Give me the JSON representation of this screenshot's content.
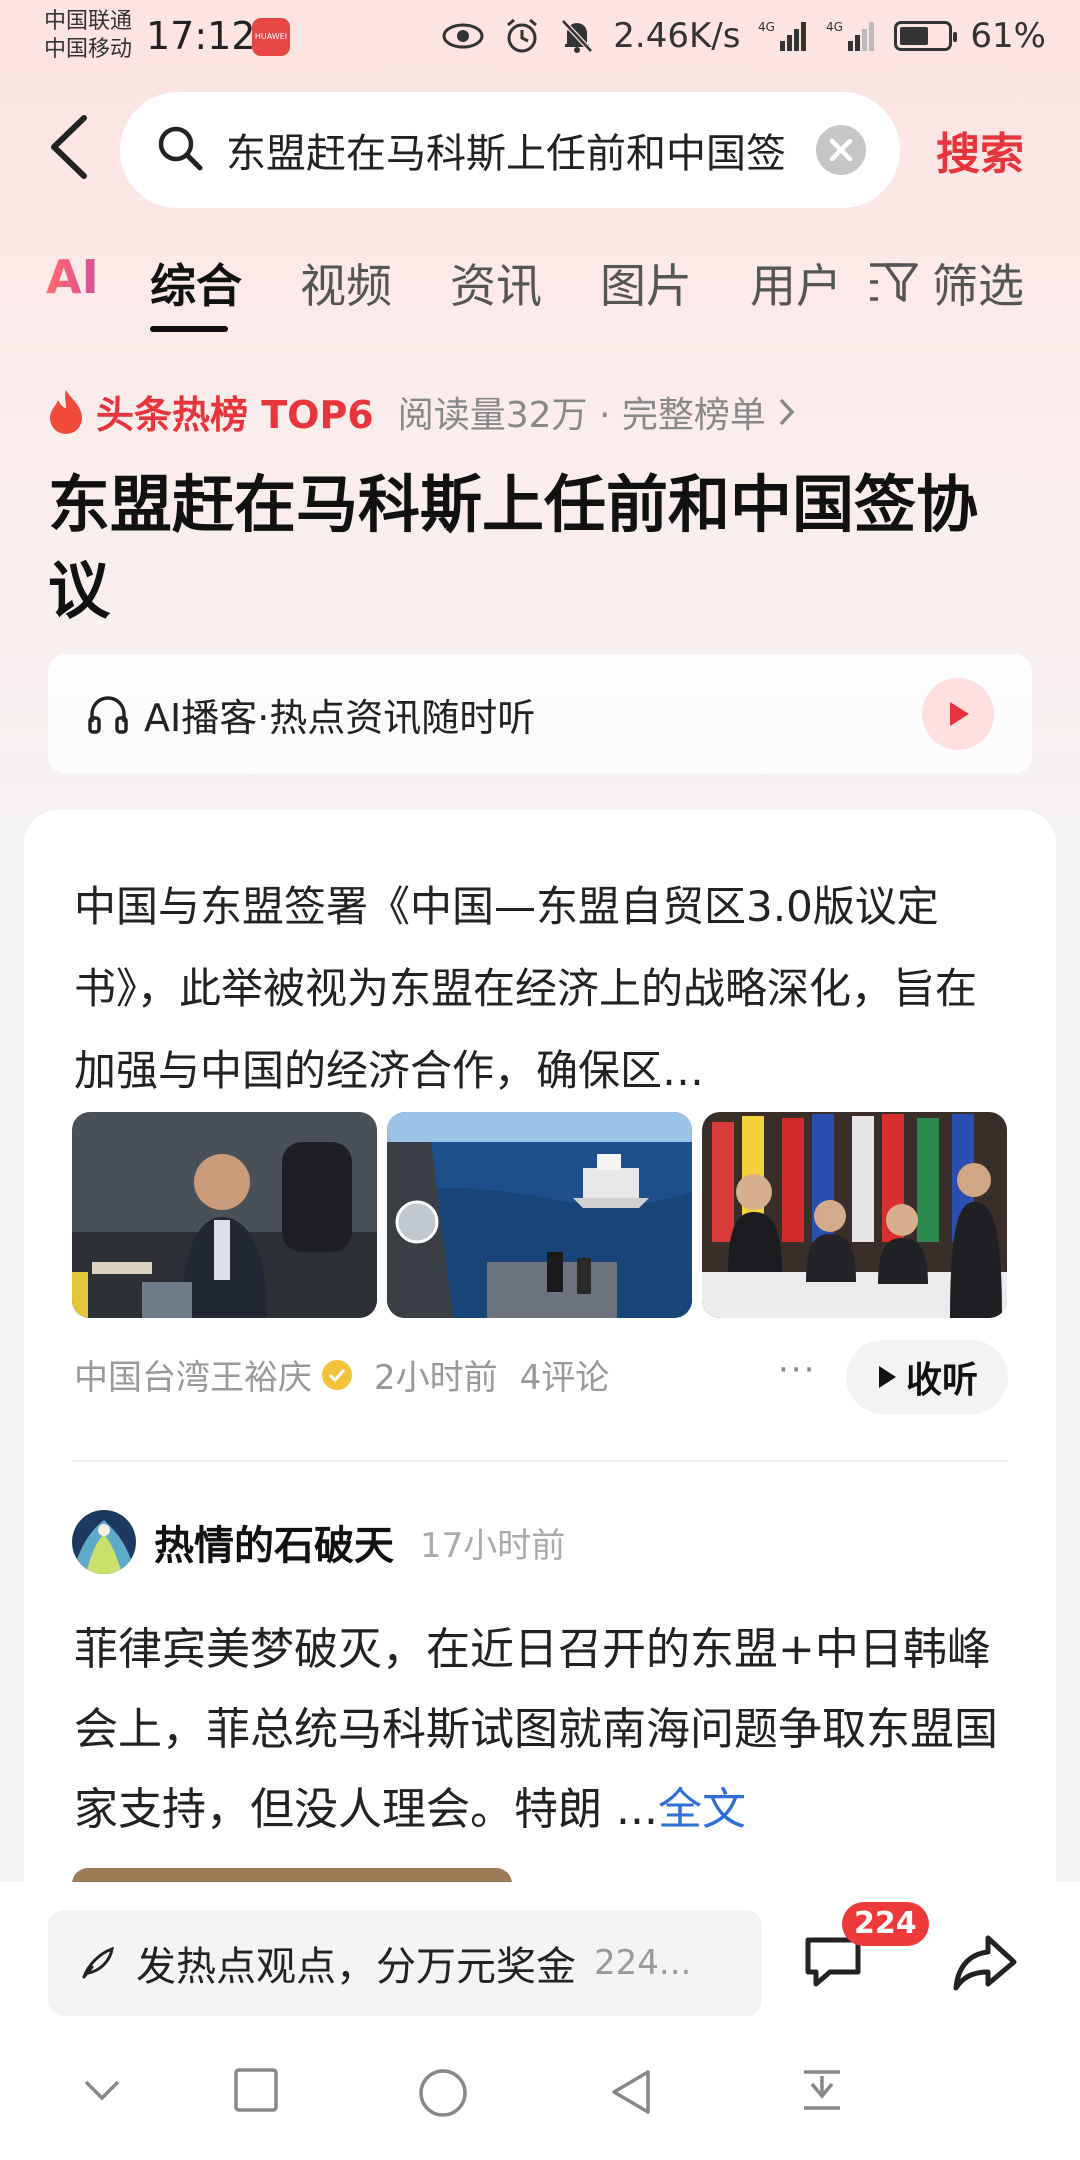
{
  "status_bar": {
    "carrier_1": "中国联通",
    "carrier_2": "中国移动",
    "time": "17:12",
    "app_badge": "HUAWEI",
    "net_speed": "2.46K/s",
    "signal_1": "4G",
    "signal_2": "4G",
    "battery": "61%",
    "battery_level": 0.61
  },
  "search": {
    "query": "东盟赶在马科斯上任前和中国签协议",
    "submit_label": "搜索"
  },
  "tabs": [
    {
      "label": "AI"
    },
    {
      "label": "综合"
    },
    {
      "label": "视频"
    },
    {
      "label": "资讯"
    },
    {
      "label": "图片"
    },
    {
      "label": "用户"
    },
    {
      "label": "筛选"
    }
  ],
  "hot": {
    "label": "头条热榜 TOP6",
    "meta": "阅读量32万 · 完整榜单"
  },
  "headline": "东盟赶在马科斯上任前和中国签协议",
  "podcast": {
    "label": "AI播客·热点资讯随时听"
  },
  "article": {
    "summary": "中国与东盟签署《中国—东盟自贸区3.0版议定书》，此举被视为东盟在经济上的战略深化，旨在加强与中国的经济合作，确保区…",
    "author": "中国台湾王裕庆",
    "time": "2小时前",
    "comments": "4评论",
    "more": "···",
    "listen_label": "收听"
  },
  "post": {
    "username": "热情的石破天",
    "time": "17小时前",
    "body": "菲律宾美梦破灭，在近日召开的东盟+中日韩峰会上，菲总统马科斯试图就南海问题争取东盟国家支持，但没人理会。特朗 ...",
    "full_link": "全文"
  },
  "bottom_bar": {
    "comment_placeholder": "发热点观点，分万元奖金",
    "comment_count_inline": "224...",
    "comment_badge": "224"
  },
  "colors": {
    "accent_red": "#e8343c",
    "link_blue": "#2f6fd6"
  }
}
